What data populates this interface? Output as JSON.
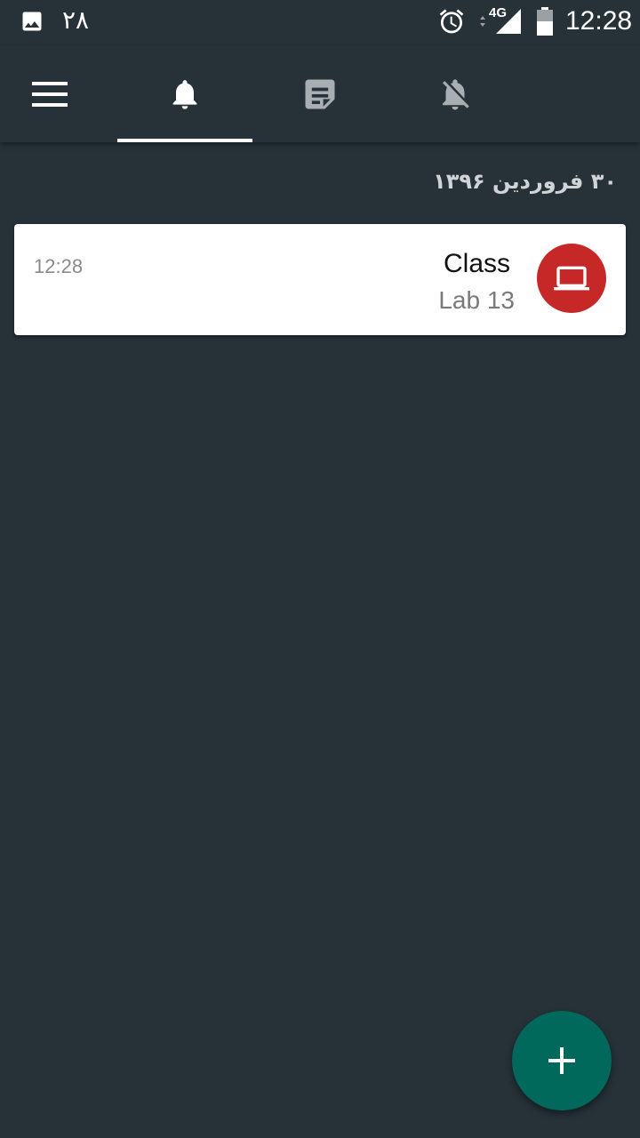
{
  "status_bar": {
    "notification_count": "۲۸",
    "network_type": "4G",
    "time": "12:28",
    "icons": [
      "image-icon",
      "alarm-icon",
      "signal-icon",
      "battery-icon"
    ]
  },
  "toolbar": {
    "menu_icon": "menu-icon",
    "tabs": [
      {
        "icon": "bell-icon",
        "selected": true
      },
      {
        "icon": "note-icon",
        "selected": false
      },
      {
        "icon": "bell-off-icon",
        "selected": false
      }
    ],
    "indicator_color": "#ffffff"
  },
  "date_header": "۳۰ فروردین ۱۳۹۶",
  "items": [
    {
      "time": "12:28",
      "title": "Class",
      "subtitle": "Lab 13",
      "icon": "laptop-icon",
      "icon_color": "#c62828"
    }
  ],
  "fab": {
    "icon": "plus-icon",
    "color": "#00695c"
  },
  "colors": {
    "background": "#263238",
    "card": "#ffffff"
  }
}
